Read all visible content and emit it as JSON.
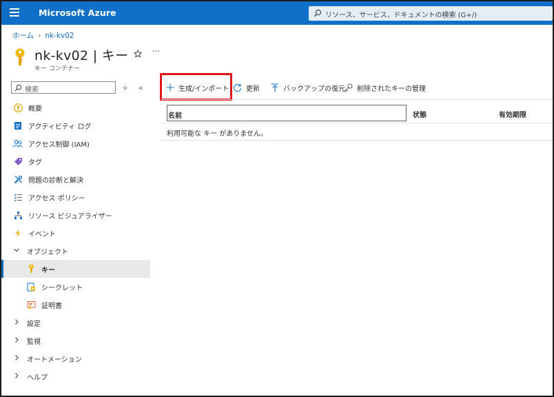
{
  "topbar": {
    "brand": "Microsoft Azure",
    "search_placeholder": "リソース、サービス、ドキュメントの検索 (G+/)"
  },
  "breadcrumb": {
    "home": "ホーム",
    "current": "nk-kv02"
  },
  "page": {
    "title": "nk-kv02 | キー",
    "subtitle": "キー コンテナー",
    "more": "···"
  },
  "sidebar": {
    "search_placeholder": "検索",
    "items": [
      {
        "label": "概要"
      },
      {
        "label": "アクティビティ ログ"
      },
      {
        "label": "アクセス制御 (IAM)"
      },
      {
        "label": "タグ"
      },
      {
        "label": "問題の診断と解決"
      },
      {
        "label": "アクセス ポリシー"
      },
      {
        "label": "リソース ビジュアライザー"
      },
      {
        "label": "イベント"
      },
      {
        "label": "オブジェクト"
      },
      {
        "label": "キー"
      },
      {
        "label": "シークレット"
      },
      {
        "label": "証明書"
      },
      {
        "label": "設定"
      },
      {
        "label": "監視"
      },
      {
        "label": "オートメーション"
      },
      {
        "label": "ヘルプ"
      }
    ]
  },
  "toolbar": {
    "generate_import": "生成/インポート",
    "refresh": "更新",
    "restore_backup": "バックアップの復元",
    "manage_deleted": "削除されたキーの管理"
  },
  "table": {
    "columns": [
      "名前",
      "状態",
      "有効期限"
    ],
    "empty_message": "利用可能な キー がありません。"
  },
  "colors": {
    "topbar": "#1070c8",
    "accent": "#0f6cbd",
    "highlight": "#e0161d",
    "key_icon": "#f2b705"
  }
}
